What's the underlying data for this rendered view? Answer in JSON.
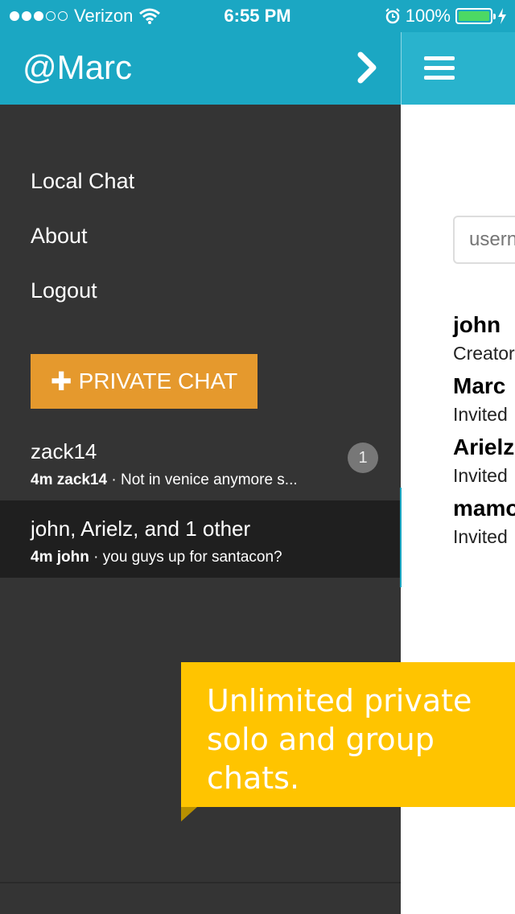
{
  "status_bar": {
    "carrier": "Verizon",
    "time": "6:55 PM",
    "battery": "100%",
    "battery_level": 1.0,
    "signal_bars_filled": 3,
    "signal_bars_total": 5
  },
  "drawer": {
    "title": "@Marc",
    "header_color": "#1ba7c3",
    "menu": [
      "Local Chat",
      "About",
      "Logout"
    ],
    "private_chat_button": "PRIVATE CHAT",
    "private_chat_color": "#e5992d",
    "chats": [
      {
        "name": "zack14",
        "time": "4m",
        "sender": "zack14",
        "message": "Not in venice anymore s...",
        "unread": "1",
        "selected": false
      },
      {
        "name": "john, Arielz, and 1 other",
        "time": "4m",
        "sender": "john",
        "message": "you guys up for santacon?",
        "selected": true
      }
    ]
  },
  "right_panel": {
    "username_placeholder": "usern",
    "members": [
      {
        "name": "john",
        "role": "Creator"
      },
      {
        "name": "Marc",
        "role": "Invited"
      },
      {
        "name": "Arielz",
        "role": "Invited"
      },
      {
        "name": "mamo",
        "role": "Invited"
      }
    ]
  },
  "callout": {
    "text": "Unlimited private solo and group chats.",
    "color": "#ffc400"
  },
  "icons": [
    "wifi-icon",
    "alarm-icon",
    "charging-icon",
    "chevron-right-icon",
    "hamburger-menu-icon",
    "plus-icon"
  ]
}
